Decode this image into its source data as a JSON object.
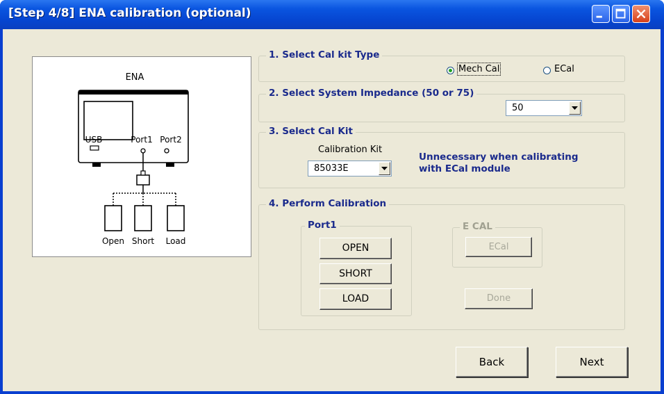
{
  "window": {
    "title": "[Step 4/8] ENA calibration (optional)"
  },
  "illustration": {
    "device_label": "ENA",
    "usb_label": "USB",
    "port1_label": "Port1",
    "port2_label": "Port2",
    "open_label": "Open",
    "short_label": "Short",
    "load_label": "Load"
  },
  "section1": {
    "legend": "1. Select Cal kit Type",
    "options": [
      "Mech Cal",
      "ECal"
    ],
    "selected": "Mech Cal"
  },
  "section2": {
    "legend": "2. Select System Impedance (50 or 75)",
    "impedance_value": "50"
  },
  "section3": {
    "legend": "3. Select Cal Kit",
    "kit_label": "Calibration Kit",
    "kit_value": "85033E",
    "note_line1": "Unnecessary when calibrating",
    "note_line2": "with ECal module"
  },
  "section4": {
    "legend": "4. Perform Calibration",
    "port1_legend": "Port1",
    "open_button": "OPEN",
    "short_button": "SHORT",
    "load_button": "LOAD",
    "ecal_legend": "E CAL",
    "ecal_button": "ECal",
    "done_button": "Done"
  },
  "footer": {
    "back_button": "Back",
    "next_button": "Next"
  }
}
